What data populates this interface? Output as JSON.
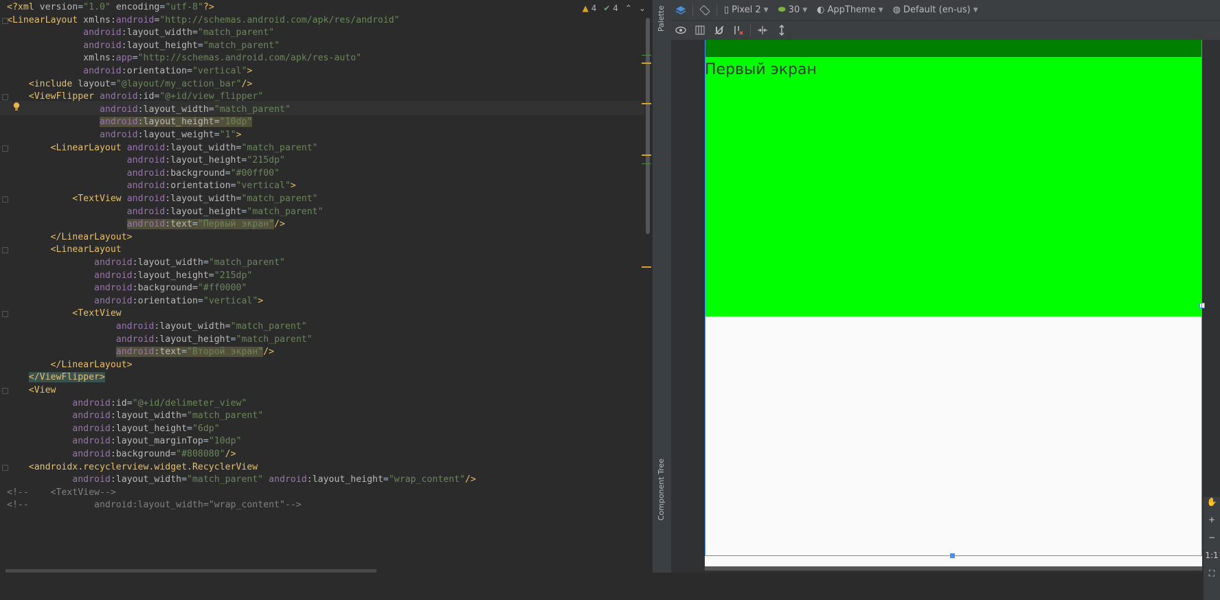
{
  "inspection": {
    "warnings": "4",
    "checks": "4"
  },
  "code_lines": [
    [
      [
        "tag",
        "<?xml "
      ],
      [
        "attr",
        "version"
      ],
      [
        "plain",
        "="
      ],
      [
        "val",
        "\"1.0\""
      ],
      [
        "plain",
        " "
      ],
      [
        "attr",
        "encoding"
      ],
      [
        "plain",
        "="
      ],
      [
        "val",
        "\"utf-8\""
      ],
      [
        "tag",
        "?>"
      ]
    ],
    [
      [
        "tag",
        "<LinearLayout "
      ],
      [
        "attr",
        "xmlns:"
      ],
      [
        "ns",
        "android"
      ],
      [
        "plain",
        "="
      ],
      [
        "val",
        "\"http://schemas.android.com/apk/res/android\""
      ]
    ],
    [
      [
        "plain",
        "              "
      ],
      [
        "ns",
        "android"
      ],
      [
        "plain",
        ":"
      ],
      [
        "attr",
        "layout_width"
      ],
      [
        "plain",
        "="
      ],
      [
        "val",
        "\"match_parent\""
      ]
    ],
    [
      [
        "plain",
        "              "
      ],
      [
        "ns",
        "android"
      ],
      [
        "plain",
        ":"
      ],
      [
        "attr",
        "layout_height"
      ],
      [
        "plain",
        "="
      ],
      [
        "val",
        "\"match_parent\""
      ]
    ],
    [
      [
        "plain",
        "              "
      ],
      [
        "attr",
        "xmlns:"
      ],
      [
        "ns",
        "app"
      ],
      [
        "plain",
        "="
      ],
      [
        "val",
        "\"http://schemas.android.com/apk/res-auto\""
      ]
    ],
    [
      [
        "plain",
        "              "
      ],
      [
        "ns",
        "android"
      ],
      [
        "plain",
        ":"
      ],
      [
        "attr",
        "orientation"
      ],
      [
        "plain",
        "="
      ],
      [
        "val",
        "\"vertical\""
      ],
      [
        "tag",
        ">"
      ]
    ],
    [
      [
        "plain",
        "    "
      ],
      [
        "tag",
        "<include "
      ],
      [
        "attr",
        "layout"
      ],
      [
        "plain",
        "="
      ],
      [
        "val",
        "\"@layout/my_action_bar\""
      ],
      [
        "tag",
        "/>"
      ]
    ],
    [
      [
        "plain",
        "    "
      ],
      [
        "tag",
        "<ViewFlipper "
      ],
      [
        "ns",
        "android"
      ],
      [
        "plain",
        ":"
      ],
      [
        "attr",
        "id"
      ],
      [
        "plain",
        "="
      ],
      [
        "val",
        "\"@+id/view_flipper\""
      ]
    ],
    [
      [
        "plain",
        "                 "
      ],
      [
        "ns",
        "android"
      ],
      [
        "plain",
        ":"
      ],
      [
        "attr",
        "layout_width"
      ],
      [
        "plain",
        "="
      ],
      [
        "val",
        "\"match_parent\""
      ]
    ],
    [
      [
        "plain",
        "                 "
      ],
      [
        "hl",
        [
          [
            "ns",
            "android"
          ],
          [
            "plain",
            ":"
          ],
          [
            "attr",
            "layout_height"
          ],
          [
            "plain",
            "="
          ],
          [
            "val",
            "\"10dp\""
          ]
        ]
      ]
    ],
    [
      [
        "plain",
        "                 "
      ],
      [
        "ns",
        "android"
      ],
      [
        "plain",
        ":"
      ],
      [
        "attr",
        "layout_weight"
      ],
      [
        "plain",
        "="
      ],
      [
        "val",
        "\"1\""
      ],
      [
        "tag",
        ">"
      ]
    ],
    [
      [
        "plain",
        "        "
      ],
      [
        "tag",
        "<LinearLayout "
      ],
      [
        "ns",
        "android"
      ],
      [
        "plain",
        ":"
      ],
      [
        "attr",
        "layout_width"
      ],
      [
        "plain",
        "="
      ],
      [
        "val",
        "\"match_parent\""
      ]
    ],
    [
      [
        "plain",
        "                      "
      ],
      [
        "ns",
        "android"
      ],
      [
        "plain",
        ":"
      ],
      [
        "attr",
        "layout_height"
      ],
      [
        "plain",
        "="
      ],
      [
        "val",
        "\"215dp\""
      ]
    ],
    [
      [
        "plain",
        "                      "
      ],
      [
        "ns",
        "android"
      ],
      [
        "plain",
        ":"
      ],
      [
        "attr",
        "background"
      ],
      [
        "plain",
        "="
      ],
      [
        "val",
        "\"#00ff00\""
      ]
    ],
    [
      [
        "plain",
        "                      "
      ],
      [
        "ns",
        "android"
      ],
      [
        "plain",
        ":"
      ],
      [
        "attr",
        "orientation"
      ],
      [
        "plain",
        "="
      ],
      [
        "val",
        "\"vertical\""
      ],
      [
        "tag",
        ">"
      ]
    ],
    [
      [
        "plain",
        "            "
      ],
      [
        "tag",
        "<TextView "
      ],
      [
        "ns",
        "android"
      ],
      [
        "plain",
        ":"
      ],
      [
        "attr",
        "layout_width"
      ],
      [
        "plain",
        "="
      ],
      [
        "val",
        "\"match_parent\""
      ]
    ],
    [
      [
        "plain",
        "                      "
      ],
      [
        "ns",
        "android"
      ],
      [
        "plain",
        ":"
      ],
      [
        "attr",
        "layout_height"
      ],
      [
        "plain",
        "="
      ],
      [
        "val",
        "\"match_parent\""
      ]
    ],
    [
      [
        "plain",
        "                      "
      ],
      [
        "hl",
        [
          [
            "ns",
            "android"
          ],
          [
            "plain",
            ":"
          ],
          [
            "attr",
            "text"
          ],
          [
            "plain",
            "="
          ],
          [
            "val",
            "\"Первый экран\""
          ]
        ]
      ],
      [
        "tag",
        "/>"
      ]
    ],
    [
      [
        "plain",
        "        "
      ],
      [
        "tag",
        "</LinearLayout>"
      ]
    ],
    [
      [
        "plain",
        "        "
      ],
      [
        "tag",
        "<LinearLayout"
      ]
    ],
    [
      [
        "plain",
        "                "
      ],
      [
        "ns",
        "android"
      ],
      [
        "plain",
        ":"
      ],
      [
        "attr",
        "layout_width"
      ],
      [
        "plain",
        "="
      ],
      [
        "val",
        "\"match_parent\""
      ]
    ],
    [
      [
        "plain",
        "                "
      ],
      [
        "ns",
        "android"
      ],
      [
        "plain",
        ":"
      ],
      [
        "attr",
        "layout_height"
      ],
      [
        "plain",
        "="
      ],
      [
        "val",
        "\"215dp\""
      ]
    ],
    [
      [
        "plain",
        "                "
      ],
      [
        "ns",
        "android"
      ],
      [
        "plain",
        ":"
      ],
      [
        "attr",
        "background"
      ],
      [
        "plain",
        "="
      ],
      [
        "val",
        "\"#ff0000\""
      ]
    ],
    [
      [
        "plain",
        "                "
      ],
      [
        "ns",
        "android"
      ],
      [
        "plain",
        ":"
      ],
      [
        "attr",
        "orientation"
      ],
      [
        "plain",
        "="
      ],
      [
        "val",
        "\"vertical\""
      ],
      [
        "tag",
        ">"
      ]
    ],
    [
      [
        "plain",
        "            "
      ],
      [
        "tag",
        "<TextView"
      ]
    ],
    [
      [
        "plain",
        "                    "
      ],
      [
        "ns",
        "android"
      ],
      [
        "plain",
        ":"
      ],
      [
        "attr",
        "layout_width"
      ],
      [
        "plain",
        "="
      ],
      [
        "val",
        "\"match_parent\""
      ]
    ],
    [
      [
        "plain",
        "                    "
      ],
      [
        "ns",
        "android"
      ],
      [
        "plain",
        ":"
      ],
      [
        "attr",
        "layout_height"
      ],
      [
        "plain",
        "="
      ],
      [
        "val",
        "\"match_parent\""
      ]
    ],
    [
      [
        "plain",
        "                    "
      ],
      [
        "hl",
        [
          [
            "ns",
            "android"
          ],
          [
            "plain",
            ":"
          ],
          [
            "attr",
            "text"
          ],
          [
            "plain",
            "="
          ],
          [
            "val",
            "\"Второй экран\""
          ]
        ]
      ],
      [
        "tag",
        "/>"
      ]
    ],
    [
      [
        "plain",
        "        "
      ],
      [
        "tag",
        "</LinearLayout>"
      ]
    ],
    [
      [
        "plain",
        "    "
      ],
      [
        "hltag",
        [
          [
            "tag",
            "</ViewFlipper>"
          ]
        ]
      ]
    ],
    [
      [
        "plain",
        "    "
      ],
      [
        "tag",
        "<View"
      ]
    ],
    [
      [
        "plain",
        "            "
      ],
      [
        "ns",
        "android"
      ],
      [
        "plain",
        ":"
      ],
      [
        "attr",
        "id"
      ],
      [
        "plain",
        "="
      ],
      [
        "val",
        "\"@+id/delimeter_view\""
      ]
    ],
    [
      [
        "plain",
        "            "
      ],
      [
        "ns",
        "android"
      ],
      [
        "plain",
        ":"
      ],
      [
        "attr",
        "layout_width"
      ],
      [
        "plain",
        "="
      ],
      [
        "val",
        "\"match_parent\""
      ]
    ],
    [
      [
        "plain",
        "            "
      ],
      [
        "ns",
        "android"
      ],
      [
        "plain",
        ":"
      ],
      [
        "attr",
        "layout_height"
      ],
      [
        "plain",
        "="
      ],
      [
        "val",
        "\"6dp\""
      ]
    ],
    [
      [
        "plain",
        "            "
      ],
      [
        "ns",
        "android"
      ],
      [
        "plain",
        ":"
      ],
      [
        "attr",
        "layout_marginTop"
      ],
      [
        "plain",
        "="
      ],
      [
        "val",
        "\"10dp\""
      ]
    ],
    [
      [
        "plain",
        "            "
      ],
      [
        "ns",
        "android"
      ],
      [
        "plain",
        ":"
      ],
      [
        "attr",
        "background"
      ],
      [
        "plain",
        "="
      ],
      [
        "val",
        "\"#808080\""
      ],
      [
        "tag",
        "/>"
      ]
    ],
    [
      [
        "plain",
        "    "
      ],
      [
        "tag",
        "<androidx.recyclerview.widget.RecyclerView"
      ]
    ],
    [
      [
        "plain",
        "            "
      ],
      [
        "ns",
        "android"
      ],
      [
        "plain",
        ":"
      ],
      [
        "attr",
        "layout_width"
      ],
      [
        "plain",
        "="
      ],
      [
        "val",
        "\"match_parent\""
      ],
      [
        "plain",
        " "
      ],
      [
        "ns",
        "android"
      ],
      [
        "plain",
        ":"
      ],
      [
        "attr",
        "layout_height"
      ],
      [
        "plain",
        "="
      ],
      [
        "val",
        "\"wrap_content\""
      ],
      [
        "tag",
        "/>"
      ]
    ],
    [
      [
        "cmt",
        "<!--    <TextView-->"
      ]
    ],
    [
      [
        "cmt",
        "<!--            android:layout_width=\"wrap_content\"-->"
      ]
    ]
  ],
  "side_labels": {
    "palette": "Palette",
    "component_tree": "Component Tree"
  },
  "toolbar": {
    "device": "Pixel 2",
    "api": "30",
    "theme": "AppTheme",
    "locale": "Default (en-us)"
  },
  "zoom": {
    "one_to_one": "1:1"
  },
  "preview": {
    "first_screen_text": "Первый экран"
  },
  "colors": {
    "green_bg": "#00ff00",
    "action_bar": "#008000",
    "selection": "#4b8ef5"
  },
  "icons": [
    "layers-icon",
    "orientation-icon",
    "phone-icon",
    "android-icon",
    "theme-icon",
    "globe-icon",
    "eye-icon",
    "blueprint-icon",
    "magnet-icon",
    "clear-constraints-icon",
    "horizontal-guide-icon",
    "vertical-guide-icon",
    "pan-icon",
    "zoom-in-icon",
    "zoom-out-icon",
    "fit-screen-icon"
  ]
}
